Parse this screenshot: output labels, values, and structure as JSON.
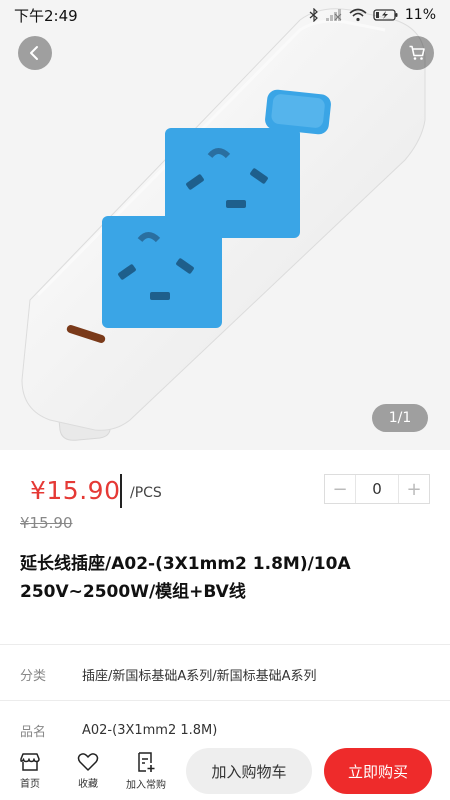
{
  "status_bar": {
    "time": "下午2:49",
    "battery": "11%",
    "icons": [
      "bluetooth-icon",
      "signal-icon",
      "wifi-icon",
      "battery-icon"
    ]
  },
  "product_image": {
    "page_indicator": "1/1",
    "icons": [
      "back-icon",
      "cart-icon"
    ]
  },
  "price": {
    "current": "¥15.90",
    "unit": "/PCS",
    "original": "¥15.90"
  },
  "quantity": {
    "minus": "−",
    "value": "0",
    "plus": "+"
  },
  "product": {
    "title": "延长线插座/A02-(3X1mm2 1.8M)/10A 250V~2500W/模组+BV线"
  },
  "specs": [
    {
      "label": "分类",
      "value": "插座/新国标基础A系列/新国标基础A系列"
    },
    {
      "label": "品名",
      "value": "A02-(3X1mm2 1.8M)"
    }
  ],
  "bottom_bar": {
    "home_label": "首页",
    "favorite_label": "收藏",
    "frequent_label": "加入常购",
    "add_to_cart_label": "加入购物车",
    "buy_now_label": "立即购买"
  },
  "colors": {
    "accent_red": "#ee2b2b",
    "price_red": "#e53935",
    "socket_blue": "#3aa5e6"
  }
}
